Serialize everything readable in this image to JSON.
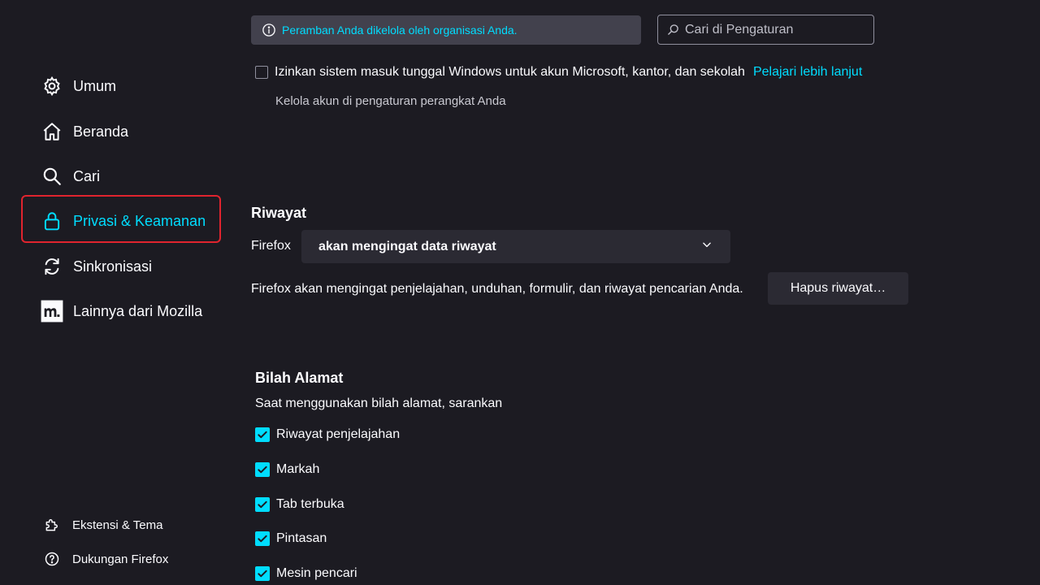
{
  "colors": {
    "background": "#1c1b22",
    "accent": "#00ddff",
    "panel": "#2b2a33",
    "highlight_frame": "#e0242e"
  },
  "sidebar": {
    "items": [
      {
        "label": "Umum",
        "icon": "gear-icon"
      },
      {
        "label": "Beranda",
        "icon": "home-icon"
      },
      {
        "label": "Cari",
        "icon": "search-icon"
      },
      {
        "label": "Privasi & Keamanan",
        "icon": "lock-icon",
        "selected": true
      },
      {
        "label": "Sinkronisasi",
        "icon": "sync-icon"
      },
      {
        "label": "Lainnya dari Mozilla",
        "icon": "mozilla-icon"
      }
    ],
    "footer": [
      {
        "label": "Ekstensi & Tema",
        "icon": "puzzle-icon"
      },
      {
        "label": "Dukungan Firefox",
        "icon": "help-icon"
      }
    ]
  },
  "topbar": {
    "policy_notice": "Peramban Anda dikelola oleh organisasi Anda.",
    "search_placeholder": "Cari di Pengaturan"
  },
  "account": {
    "sso_label": "Izinkan sistem masuk tunggal Windows untuk akun Microsoft, kantor, dan sekolah",
    "learn_more": "Pelajari lebih lanjut",
    "manage_note": "Kelola akun di pengaturan perangkat Anda"
  },
  "history": {
    "title": "Riwayat",
    "firefox_prefix": "Firefox",
    "mode_selected": "akan mengingat data riwayat",
    "description": "Firefox akan mengingat penjelajahan, unduhan, formulir, dan riwayat pencarian Anda.",
    "clear_button": "Hapus riwayat…"
  },
  "address_bar": {
    "title": "Bilah Alamat",
    "description": "Saat menggunakan bilah alamat, sarankan",
    "options": [
      {
        "label": "Riwayat penjelajahan",
        "checked": true
      },
      {
        "label": "Markah",
        "checked": true
      },
      {
        "label": "Tab terbuka",
        "checked": true
      },
      {
        "label": "Pintasan",
        "checked": true
      },
      {
        "label": "Mesin pencari",
        "checked": true
      }
    ]
  }
}
